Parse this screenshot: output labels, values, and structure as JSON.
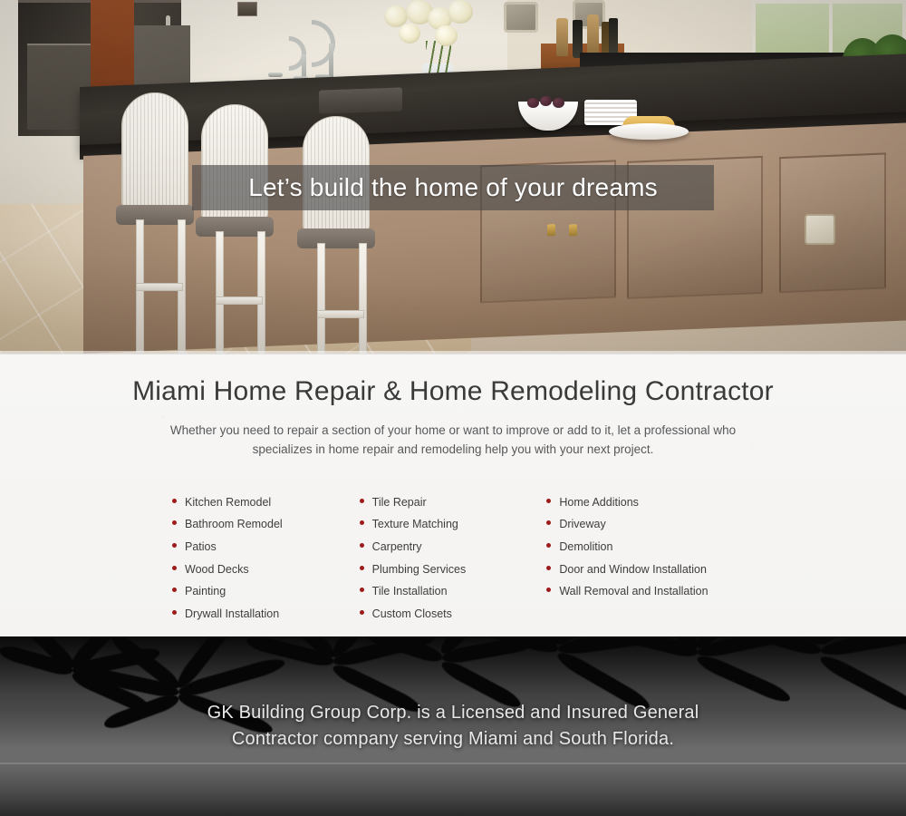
{
  "hero": {
    "overlay_title": "Let’s build the home of your dreams",
    "image_alt": "luxury-kitchen-island-photo"
  },
  "intro": {
    "title": "Miami Home Repair & Home Remodeling Contractor",
    "subtitle": "Whether you need to repair a section of your home or want to improve or add to it, let a professional who specializes in home repair and remodeling help you with your next project."
  },
  "services": {
    "bullet_color": "#9e1b1b",
    "columns": [
      {
        "items": [
          "Kitchen Remodel",
          "Bathroom Remodel",
          "Patios",
          "Wood Decks",
          "Painting",
          "Drywall Installation"
        ]
      },
      {
        "items": [
          "Tile Repair",
          "Texture Matching",
          "Carpentry",
          "Plumbing Services",
          "Tile Installation",
          "Custom Closets"
        ]
      },
      {
        "items": [
          "Home Additions",
          "Driveway",
          "Demolition",
          "Door and Window Installation",
          "Wall Removal and Installation"
        ]
      }
    ]
  },
  "footer": {
    "line1": "GK Building Group Corp. is a Licensed and Insured General",
    "line2": "Contractor company serving Miami and South Florida.",
    "image_alt": "palm-trees-beach-silhouette-photo"
  },
  "colors": {
    "accent_red": "#9e1b1b",
    "heading_gray": "#3a3a3a",
    "body_gray": "#57585a",
    "section_bg": "#f6f5f3",
    "overlay": "rgba(70,70,70,0.62)"
  }
}
